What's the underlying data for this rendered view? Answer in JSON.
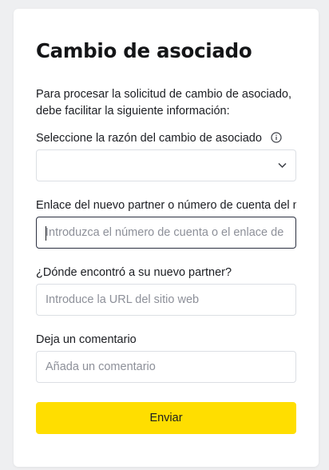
{
  "form": {
    "title": "Cambio de asociado",
    "intro": "Para procesar la solicitud de cambio de asociado, debe facilitar la siguiente información:",
    "reason": {
      "label": "Seleccione la razón del cambio de asociado",
      "value": ""
    },
    "new_partner": {
      "label": "Enlace del nuevo partner o número de cuenta del nuevo partner",
      "placeholder": "Introduzca el número de cuenta o el enlace de"
    },
    "where_found": {
      "label": "¿Dónde encontró a su nuevo partner?",
      "placeholder": "Introduce la URL del sitio web"
    },
    "comment": {
      "label": "Deja un comentario",
      "placeholder": "Añada un comentario"
    },
    "submit_label": "Enviar"
  },
  "colors": {
    "accent": "#ffde00",
    "focus_border": "#2b3040",
    "border": "#dcdfe4",
    "placeholder": "#8d9099"
  },
  "icons": {
    "info": "info-circle-icon",
    "chevron": "chevron-down-icon"
  }
}
